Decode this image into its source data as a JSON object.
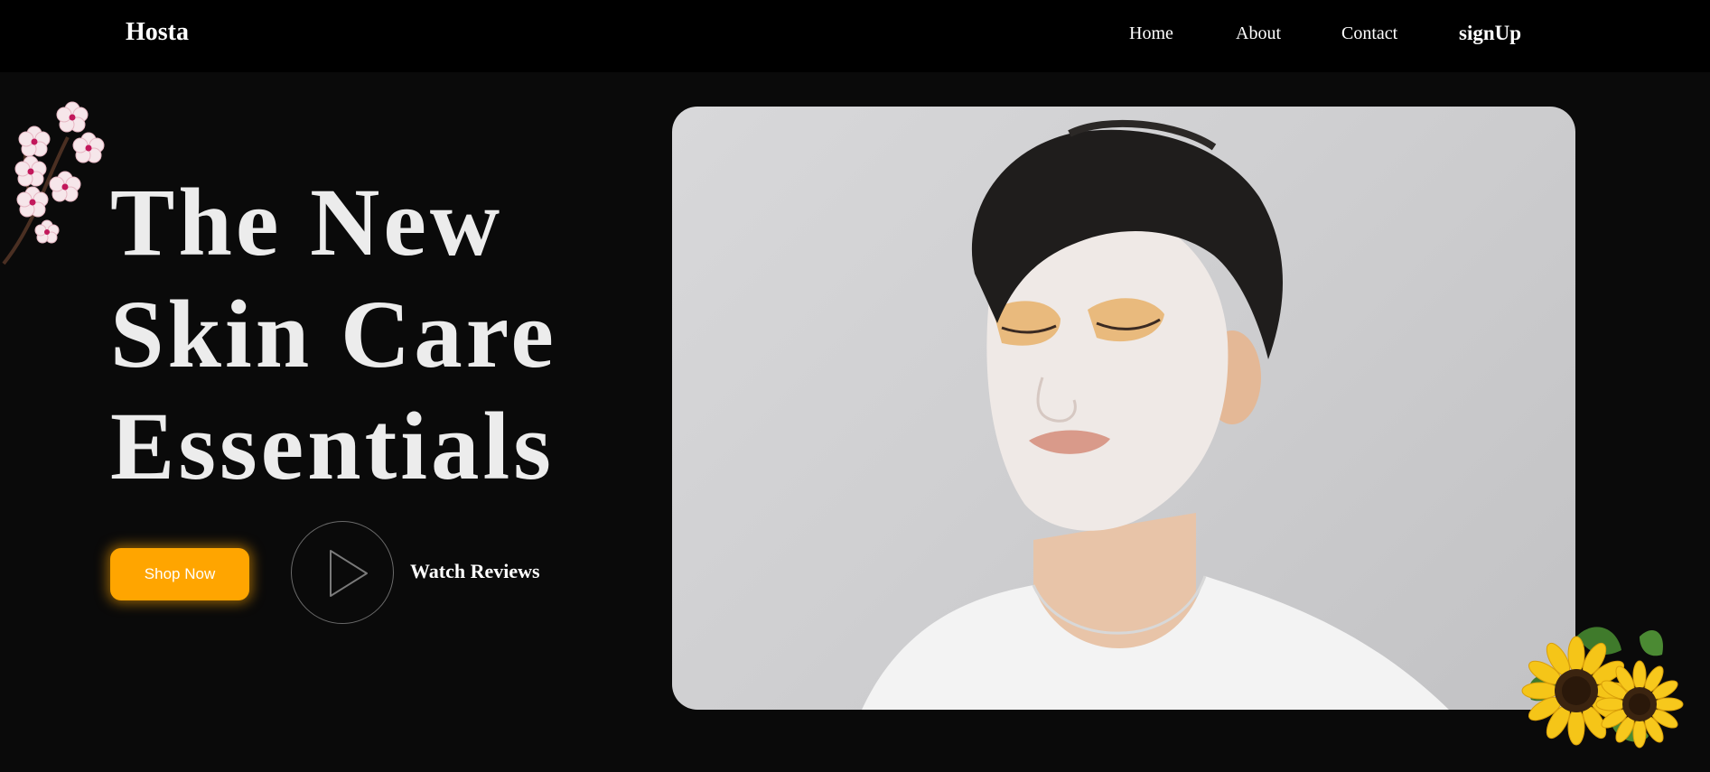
{
  "nav": {
    "brand": "Hosta",
    "links": [
      "Home",
      "About",
      "Contact"
    ],
    "signup": "signUp"
  },
  "hero": {
    "title_lines": [
      "The New",
      "Skin Care",
      "Essentials"
    ],
    "shop_button": "Shop Now",
    "watch_label": "Watch Reviews",
    "image_icon": "man-face-mask-photo"
  },
  "decor": {
    "blossom_icon": "cherry-blossom-icon",
    "sunflower_icon": "sunflower-icon"
  },
  "colors": {
    "background": "#0a0a0a",
    "nav_background": "#000000",
    "accent": "#ffa500",
    "text": "#ececec"
  }
}
